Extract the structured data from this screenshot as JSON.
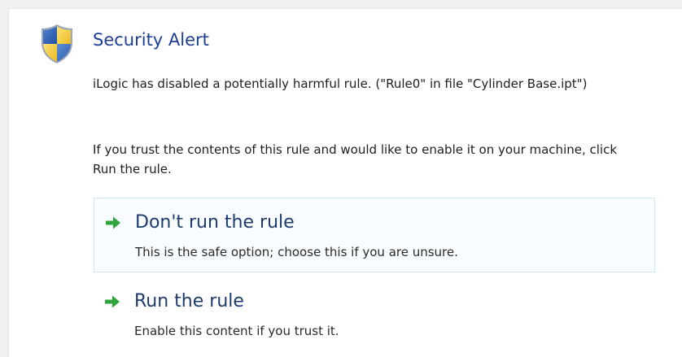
{
  "dialog": {
    "title": "Security Alert",
    "message": "iLogic has disabled a potentially harmful rule. (\"Rule0\" in file \"Cylinder Base.ipt\")",
    "instruction": "If you trust the contents of this rule and would like to enable it on your machine, click Run the rule.",
    "icon": "shield-icon"
  },
  "options": [
    {
      "label": "Don't run the rule",
      "description": "This is the safe option; choose this if you are unsure.",
      "icon": "green-arrow-icon"
    },
    {
      "label": "Run the rule",
      "description": "Enable this content if you trust it.",
      "icon": "green-arrow-icon"
    }
  ],
  "colors": {
    "title": "#1c3f95",
    "option_title": "#1e3b6e",
    "arrow": "#2fa43a",
    "highlight_border": "#cfe6f3"
  }
}
